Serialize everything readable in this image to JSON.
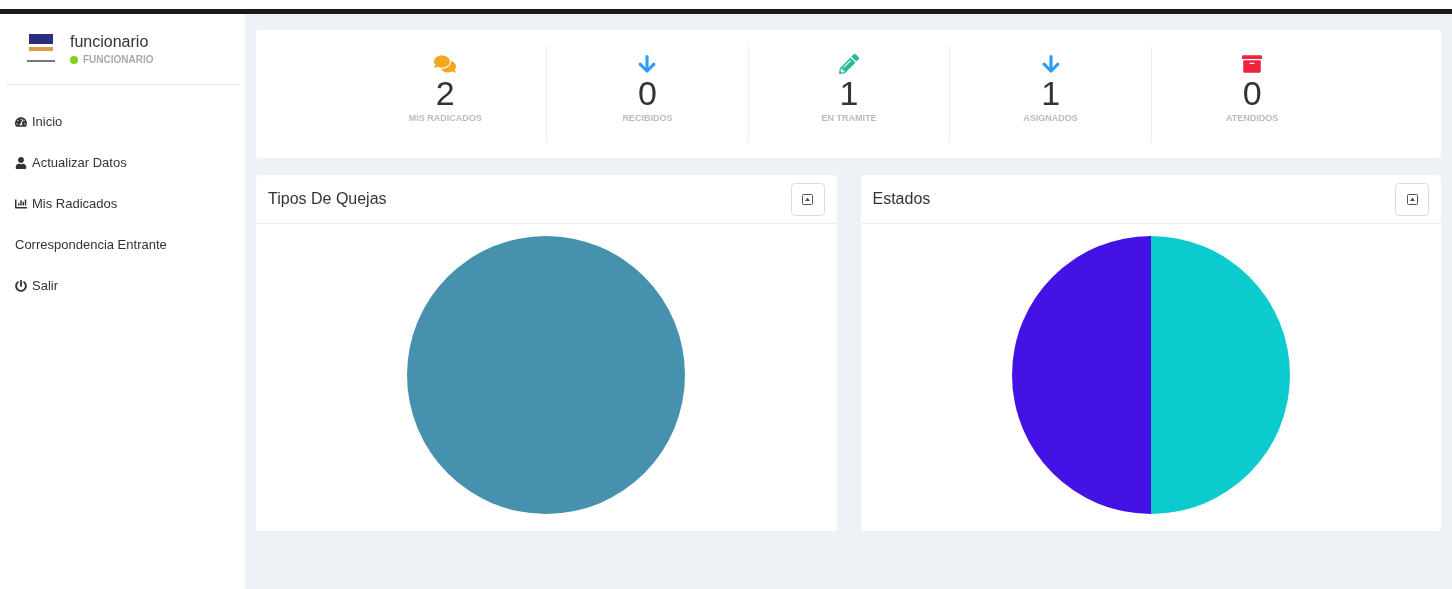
{
  "user": {
    "name": "funcionario",
    "role": "FUNCIONARIO",
    "online": true
  },
  "menu": [
    {
      "label": "Inicio"
    },
    {
      "label": "Actualizar Datos"
    },
    {
      "label": "Mis Radicados"
    },
    {
      "label": "Correspondencia Entrante"
    },
    {
      "label": "Salir"
    }
  ],
  "stats": [
    {
      "value": "2",
      "label": "MIS RADICADOS"
    },
    {
      "value": "0",
      "label": "RECIBIDOS"
    },
    {
      "value": "1",
      "label": "EN TRAMITE"
    },
    {
      "value": "1",
      "label": "ASIGNADOS"
    },
    {
      "value": "0",
      "label": "ATENDIDOS"
    }
  ],
  "panels": [
    {
      "title": "Tipos De Quejas"
    },
    {
      "title": "Estados"
    }
  ]
}
